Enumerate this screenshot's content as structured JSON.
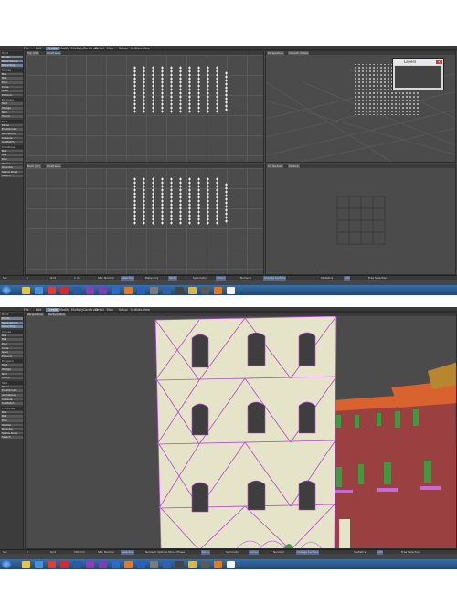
{
  "top_window": {
    "menu_tabs": [
      "File",
      "Edit",
      "Create",
      "Modify",
      "Multiply",
      "Construct",
      "Detail",
      "Map",
      "Setup",
      "Utilities",
      "View"
    ],
    "active_tab": "Create",
    "toolbar_sections": [
      "Point",
      "Curves",
      "Polygons",
      "Text",
      "Primitives"
    ],
    "toolbar_items": [
      "Points",
      "Make Spline",
      "Make Poly",
      "Box",
      "Ball",
      "Disc",
      "Cone",
      "Gear",
      "Platonic",
      "Text",
      "Wedge",
      "Null",
      "Toroid",
      "Plane",
      "Equilibrium",
      "Gemstone",
      "Capsule",
      "SubPatch",
      "Box",
      "Ball",
      "Disc",
      "Wedge",
      "Rounder",
      "Spline Draw",
      "Sketch"
    ],
    "viewports": [
      {
        "label": "Top (XZ)",
        "mode": "Wireframe"
      },
      {
        "label": "Perspective",
        "mode": "Smooth Shade"
      },
      {
        "label": "Back (XY)",
        "mode": "Wireframe"
      },
      {
        "label": "UV Texture",
        "mode": "Texture"
      }
    ],
    "layers_panel": {
      "title": "Layers",
      "close": "X"
    },
    "status": [
      "Sel",
      "0",
      "Grid",
      "1 m",
      "SEL: Normal",
      "Selection",
      "Make Poly",
      "Mode",
      "Symmetry",
      "Action",
      "Numeric",
      "Change Surface",
      "Statistics",
      "Info",
      "Free Selection"
    ]
  },
  "bottom_window": {
    "menu_tabs": [
      "File",
      "Edit",
      "Create",
      "Modify",
      "Multiply",
      "Construct",
      "Detail",
      "Map",
      "Setup",
      "Utilities",
      "View"
    ],
    "active_tab": "Create",
    "toolbar_sections": [
      "Point",
      "Curves",
      "Polygons",
      "Text",
      "Primitives"
    ],
    "toolbar_items": [
      "Points",
      "Make Spline",
      "Make Poly",
      "Box",
      "Ball",
      "Disc",
      "Cone",
      "Gear",
      "Platonic",
      "Text",
      "Wedge",
      "Null",
      "Toroid",
      "Plane",
      "Equilibrium",
      "Gemstone",
      "Capsule",
      "SubPatch",
      "Box",
      "Ball",
      "Disc",
      "Wedge",
      "Rounder",
      "Spline Draw",
      "Sketch"
    ],
    "viewport": {
      "label": "Perspective",
      "mode": "Texture Wire"
    },
    "status": [
      "Sel",
      "0",
      "Grid",
      "200 mm",
      "SEL: Normal",
      "Selection",
      "Numeric Options Stone Phase",
      "Mode",
      "Symmetry",
      "Action",
      "Numeric",
      "Change Surface",
      "Statistics",
      "Info",
      "Free Selection"
    ]
  },
  "taskbar_icons": [
    "windows-start",
    "explorer",
    "media",
    "chrome",
    "opera",
    "lightwave",
    "after-effects",
    "premiere",
    "photoshop",
    "firefox",
    "word",
    "3d-app",
    "lightwave-layout",
    "audio",
    "folder",
    "game",
    "firefox-alt",
    "notepad"
  ],
  "colors": {
    "ui_bg": "#454545",
    "viewport_bg": "#4b4b4b",
    "accent": "#6b82a3",
    "building": "#e6e4c8",
    "wire": "#b04bd0",
    "roof": "#d9632e",
    "brick": "#9a4040",
    "shutter": "#3f9a3f"
  }
}
